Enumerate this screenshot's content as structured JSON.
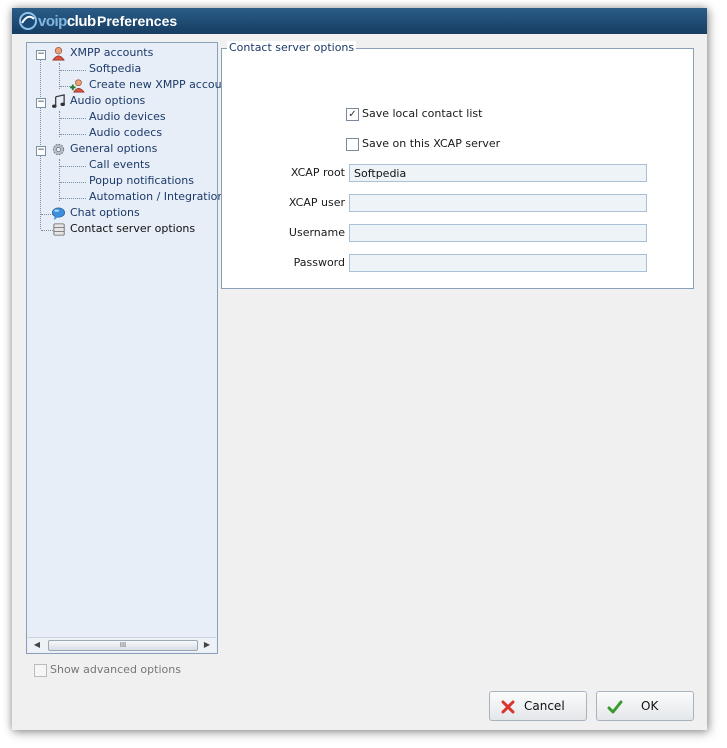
{
  "window": {
    "title": "Preferences",
    "logo_text": {
      "a": "voip",
      "b": "club"
    }
  },
  "tree": {
    "items": [
      {
        "label": "XMPP accounts",
        "level": 0,
        "icon": "user-icon"
      },
      {
        "label": "Softpedia",
        "level": 1
      },
      {
        "label": "Create new XMPP account",
        "level": 1,
        "icon": "add-user-icon"
      },
      {
        "label": "Audio options",
        "level": 0,
        "icon": "music-note-icon"
      },
      {
        "label": "Audio devices",
        "level": 1
      },
      {
        "label": "Audio codecs",
        "level": 1
      },
      {
        "label": "General options",
        "level": 0,
        "icon": "gear-icon"
      },
      {
        "label": "Call events",
        "level": 1
      },
      {
        "label": "Popup notifications",
        "level": 1
      },
      {
        "label": "Automation / Integration",
        "level": 1
      },
      {
        "label": "Chat options",
        "level": 0,
        "icon": "chat-bubble-icon"
      },
      {
        "label": "Contact server options",
        "level": 0,
        "icon": "database-icon",
        "selected": true
      }
    ],
    "scroll_grip": "III"
  },
  "contact_server": {
    "group_title": "Contact server options",
    "save_local": {
      "label": "Save local contact list",
      "checked": true
    },
    "save_xcap": {
      "label": "Save on this XCAP server",
      "checked": false
    },
    "fields": {
      "xcap_root": {
        "label": "XCAP root",
        "value": "Softpedia"
      },
      "xcap_user": {
        "label": "XCAP user",
        "value": ""
      },
      "username": {
        "label": "Username",
        "value": ""
      },
      "password": {
        "label": "Password",
        "value": ""
      }
    }
  },
  "advanced": {
    "label": "Show advanced options",
    "checked": false
  },
  "buttons": {
    "cancel": "Cancel",
    "ok": "OK"
  },
  "colors": {
    "titlebar": "#1f4a73",
    "tree_bg": "#e7eef7",
    "link_text": "#1c3a69",
    "cancel_icon": "#d9342b",
    "ok_icon": "#3a9a2f"
  }
}
